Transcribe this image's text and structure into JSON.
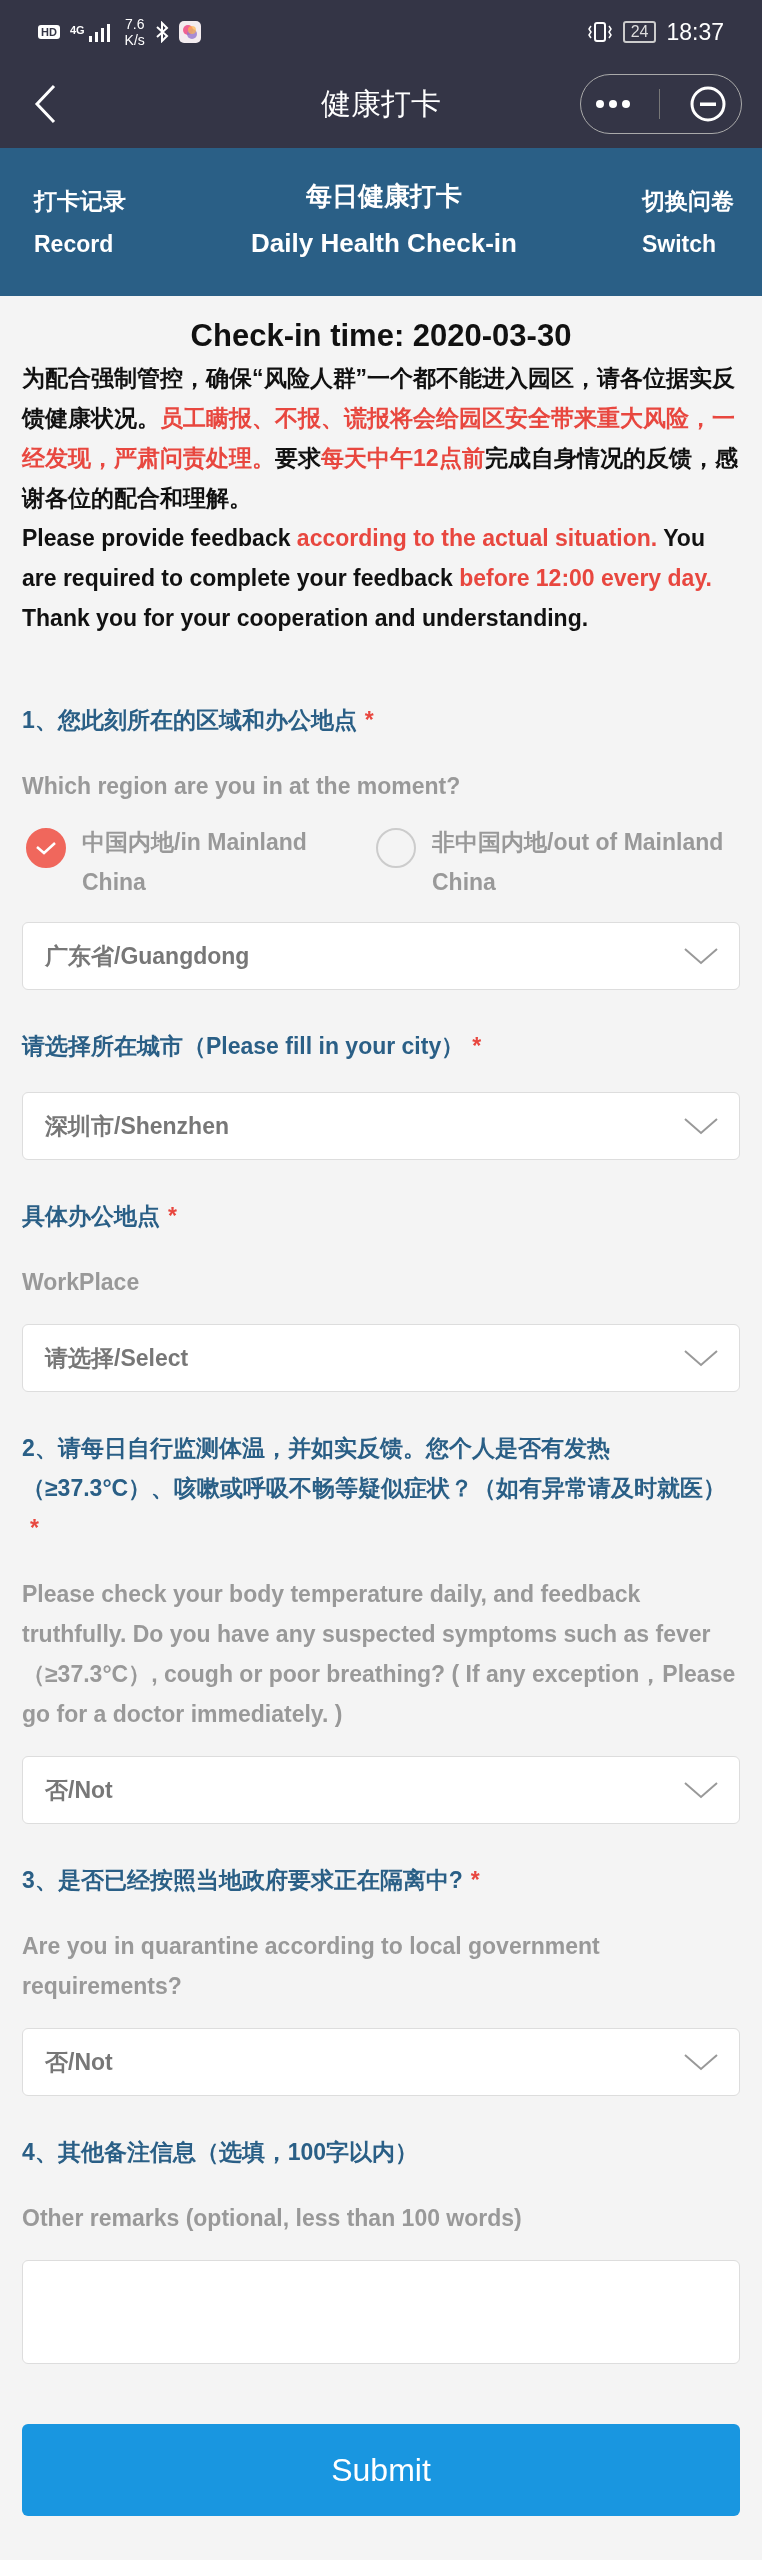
{
  "status_bar": {
    "hd": "HD",
    "network": "4G",
    "speed": "7.6",
    "speed_unit": "K/s",
    "battery": "24",
    "time": "18:37"
  },
  "nav": {
    "title": "健康打卡"
  },
  "header": {
    "left": {
      "zh": "打卡记录",
      "en": "Record"
    },
    "center": {
      "zh": "每日健康打卡",
      "en": "Daily Health Check-in"
    },
    "right": {
      "zh": "切换问卷",
      "en": "Switch"
    }
  },
  "checkin_title": "Check-in time: 2020-03-30",
  "intro": [
    [
      {
        "text": "为配合强制管控，确保“风险人群”一个都不能进入园区，请各位据实反馈健康状况。",
        "highlight": false
      },
      {
        "text": "员工瞒报、不报、谎报将会给园区安全带来重大风险，一经发现，严肃问责处理。",
        "highlight": true
      },
      {
        "text": "要求",
        "highlight": false
      },
      {
        "text": "每天中午12点前",
        "highlight": true
      },
      {
        "text": "完成自身情况的反馈，感谢各位的配合和理解。",
        "highlight": false
      }
    ],
    [
      {
        "text": "Please provide feedback ",
        "highlight": false
      },
      {
        "text": "according to the actual situation.",
        "highlight": true
      },
      {
        "text": " You are required to complete your feedback ",
        "highlight": false
      },
      {
        "text": "before 12:00 every day.",
        "highlight": true
      },
      {
        "text": " Thank you for your cooperation and understanding.",
        "highlight": false
      }
    ]
  ],
  "form_items": [
    {
      "kind": "label",
      "text": "1、您此刻所在的区域和办公地点",
      "required_mark": "*"
    },
    {
      "kind": "hint",
      "text": "Which region are you in at the moment?"
    },
    {
      "kind": "radio_group",
      "options": [
        {
          "label": "中国内地/in Mainland China",
          "selected": true
        },
        {
          "label": "非中国内地/out of Mainland China",
          "selected": false
        }
      ]
    },
    {
      "kind": "select",
      "value": "广东省/Guangdong"
    },
    {
      "kind": "label",
      "text": "请选择所在城市（Please fill in your city）",
      "required_mark": "*"
    },
    {
      "kind": "select",
      "value": "深圳市/Shenzhen"
    },
    {
      "kind": "label",
      "text": "具体办公地点",
      "required_mark": "*"
    },
    {
      "kind": "hint",
      "text": "WorkPlace"
    },
    {
      "kind": "select",
      "value": "请选择/Select"
    },
    {
      "kind": "label",
      "text": "2、请每日自行监测体温，并如实反馈。您个人是否有发热（≥37.3°C）、咳嗽或呼吸不畅等疑似症状？（如有异常请及时就医）",
      "required_mark": "*"
    },
    {
      "kind": "hint",
      "text": "Please check your body temperature daily, and feedback truthfully. Do you have any suspected symptoms such as fever（≥37.3°C）, cough or poor breathing? ( If any exception，Please go for a doctor immediately. )"
    },
    {
      "kind": "select",
      "value": "否/Not"
    },
    {
      "kind": "label",
      "text": "3、是否已经按照当地政府要求正在隔离中?",
      "required_mark": "*"
    },
    {
      "kind": "hint",
      "text": "Are you in quarantine according to local government requirements?"
    },
    {
      "kind": "select",
      "value": "否/Not"
    },
    {
      "kind": "label",
      "text": "4、其他备注信息（选填，100字以内）"
    },
    {
      "kind": "hint",
      "text": "Other remarks (optional, less than 100 words)"
    },
    {
      "kind": "textarea"
    }
  ],
  "submit": "Submit"
}
